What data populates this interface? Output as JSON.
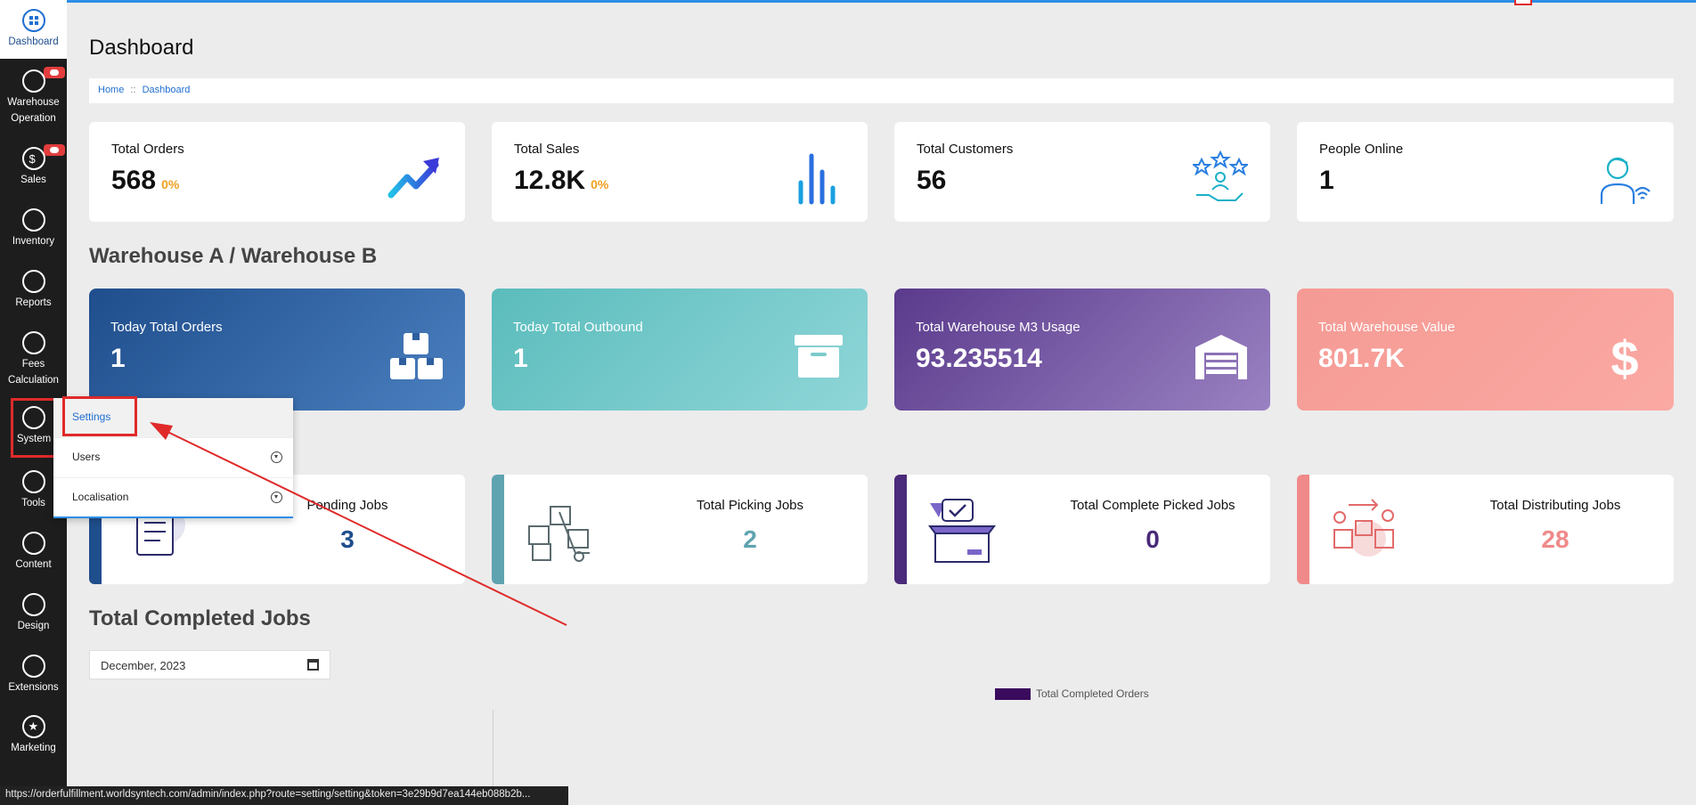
{
  "sidebar": {
    "items": [
      {
        "label": "Dashboard",
        "icon": "grid-icon"
      },
      {
        "label": "Warehouse Operation",
        "icon": "phone-icon",
        "badge": true
      },
      {
        "label": "Sales",
        "icon": "dollar-icon",
        "badge": true
      },
      {
        "label": "Inventory",
        "icon": "box-icon"
      },
      {
        "label": "Reports",
        "icon": "bar-chart-icon"
      },
      {
        "label": "Fees Calculation",
        "icon": "paperclip-icon"
      },
      {
        "label": "System",
        "icon": "cogs-icon"
      },
      {
        "label": "Tools",
        "icon": "tools-icon"
      },
      {
        "label": "Content",
        "icon": "content-icon"
      },
      {
        "label": "Design",
        "icon": "pencil-icon"
      },
      {
        "label": "Extensions",
        "icon": "share-icon"
      },
      {
        "label": "Marketing",
        "icon": "star-icon"
      }
    ]
  },
  "header": {
    "title": "Dashboard"
  },
  "breadcrumb": {
    "home": "Home",
    "sep": "::",
    "current": "Dashboard"
  },
  "stats": [
    {
      "label": "Total Orders",
      "value": "568",
      "pct": "0%"
    },
    {
      "label": "Total Sales",
      "value": "12.8K",
      "pct": "0%"
    },
    {
      "label": "Total Customers",
      "value": "56",
      "pct": ""
    },
    {
      "label": "People Online",
      "value": "1",
      "pct": ""
    }
  ],
  "warehouse": {
    "title": "Warehouse A / Warehouse B",
    "cards": [
      {
        "label": "Today Total Orders",
        "value": "1"
      },
      {
        "label": "Today Total Outbound",
        "value": "1"
      },
      {
        "label": "Total Warehouse M3 Usage",
        "value": "93.235514"
      },
      {
        "label": "Total Warehouse Value",
        "value": "801.7K"
      }
    ]
  },
  "jobs": [
    {
      "label": "Pending Jobs",
      "value": "3",
      "color": "#1f4e8c"
    },
    {
      "label": "Total Picking Jobs",
      "value": "2",
      "color": "#5fa3b0"
    },
    {
      "label": "Total Complete Picked Jobs",
      "value": "0",
      "color": "#4a2a7a"
    },
    {
      "label": "Total Distributing Jobs",
      "value": "28",
      "color": "#f08a8a"
    }
  ],
  "completed": {
    "title": "Total Completed Jobs",
    "date_value": "December, 2023",
    "legend": "Total Completed Orders"
  },
  "dropdown": {
    "items": [
      {
        "label": "Settings"
      },
      {
        "label": "Users"
      },
      {
        "label": "Localisation"
      }
    ]
  },
  "status_bar": {
    "url": "https://orderfulfillment.worldsyntech.com/admin/index.php?route=setting/setting&token=3e29b9d7ea144eb088b2b..."
  },
  "colors": {
    "accent": "#2d8ee6",
    "sidebar_bg": "#1d1d1d",
    "highlight": "#e02a2a"
  }
}
